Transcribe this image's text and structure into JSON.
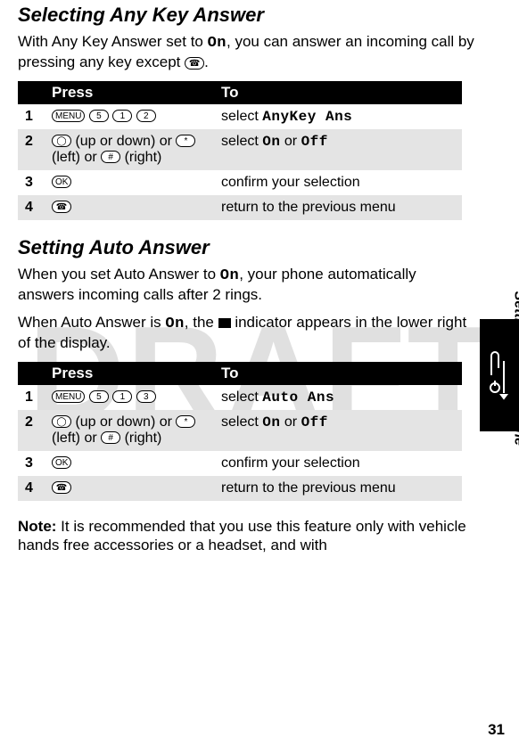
{
  "watermark": "DRAFT",
  "side_label": "Setting Up Your Phone",
  "page_number": "31",
  "section1": {
    "heading": "Selecting Any Key Answer",
    "intro_pre": "With Any Key Answer set to ",
    "intro_on": "On",
    "intro_mid": ", you can answer an incoming call by pressing any key except ",
    "intro_post": ".",
    "th_press": "Press",
    "th_to": "To",
    "rows": [
      {
        "step": "1",
        "press": [
          "MENU",
          "5",
          "1",
          "2"
        ],
        "to_pre": "select ",
        "to_lcd": "AnyKey Ans"
      },
      {
        "step": "2",
        "press_text_a": " (up or down) or ",
        "press_text_b": " (left) or ",
        "press_text_c": " (right)",
        "to_pre": "select ",
        "to_lcd_on": "On",
        "to_mid": " or ",
        "to_lcd_off": "Off"
      },
      {
        "step": "3",
        "to": "confirm your selection"
      },
      {
        "step": "4",
        "to": "return to the previous menu"
      }
    ]
  },
  "section2": {
    "heading": "Setting Auto Answer",
    "p1_pre": "When you set Auto Answer to ",
    "p1_on": "On",
    "p1_post": ", your phone automatically answers incoming calls after 2 rings.",
    "p2_pre": "When Auto Answer is ",
    "p2_on": "On",
    "p2_mid": ", the ",
    "p2_post": " indicator appears in the lower right of the display.",
    "th_press": "Press",
    "th_to": "To",
    "rows": [
      {
        "step": "1",
        "press": [
          "MENU",
          "5",
          "1",
          "3"
        ],
        "to_pre": "select ",
        "to_lcd": "Auto Ans"
      },
      {
        "step": "2",
        "press_text_a": " (up or down) or ",
        "press_text_b": " (left) or ",
        "press_text_c": " (right)",
        "to_pre": "select ",
        "to_lcd_on": "On",
        "to_mid": " or ",
        "to_lcd_off": "Off"
      },
      {
        "step": "3",
        "to": "confirm your selection"
      },
      {
        "step": "4",
        "to": "return to the previous menu"
      }
    ]
  },
  "note_label": "Note:",
  "note_text": " It is recommended that you use this feature only with vehicle hands free accessories or a headset, and with"
}
